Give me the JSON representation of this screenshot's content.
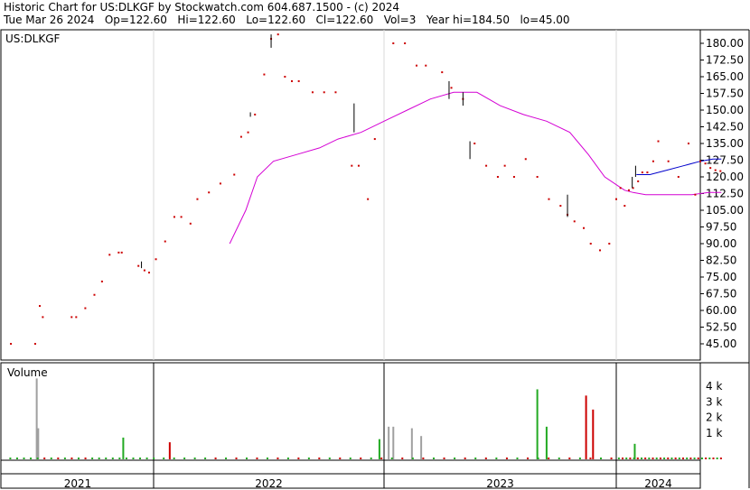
{
  "header": {
    "line1": "Historic Chart for US:DLKGF by Stockwatch.com 604.687.1500 - (c) 2024",
    "line2": "Tue Mar 26 2024   Op=122.60   Hi=122.60   Lo=122.60   Cl=122.60   Vol=3   Year hi=184.50   lo=45.00"
  },
  "chart_data": [
    {
      "type": "line",
      "title": "US:DLKGF",
      "ylim": [
        40,
        184
      ],
      "y_ticks": [
        "180.00",
        "172.50",
        "165.00",
        "157.50",
        "150.00",
        "142.50",
        "135.00",
        "127.50",
        "120.00",
        "112.50",
        "105.00",
        "97.50",
        "90.00",
        "82.50",
        "75.00",
        "67.50",
        "60.00",
        "52.50",
        "45.00"
      ],
      "x_ticks": [
        "2021",
        "2022",
        "2023",
        "2024"
      ],
      "price_points": [
        [
          0.06,
          45
        ],
        [
          0.22,
          45
        ],
        [
          0.25,
          62
        ],
        [
          0.27,
          57
        ],
        [
          0.46,
          57
        ],
        [
          0.49,
          57
        ],
        [
          0.55,
          61
        ],
        [
          0.61,
          67
        ],
        [
          0.66,
          73
        ],
        [
          0.71,
          85
        ],
        [
          0.77,
          86
        ],
        [
          0.79,
          86
        ],
        [
          0.9,
          80
        ],
        [
          0.94,
          78
        ],
        [
          0.97,
          77
        ],
        [
          1.01,
          83
        ],
        [
          1.05,
          91
        ],
        [
          1.09,
          102
        ],
        [
          1.12,
          102
        ],
        [
          1.16,
          99
        ],
        [
          1.19,
          110
        ],
        [
          1.24,
          113
        ],
        [
          1.29,
          117
        ],
        [
          1.35,
          121
        ],
        [
          1.38,
          138
        ],
        [
          1.41,
          140
        ],
        [
          1.44,
          148
        ],
        [
          1.48,
          166
        ],
        [
          1.51,
          182
        ],
        [
          1.54,
          184
        ],
        [
          1.57,
          165
        ],
        [
          1.6,
          163
        ],
        [
          1.63,
          163
        ],
        [
          1.69,
          158
        ],
        [
          1.74,
          158
        ],
        [
          1.79,
          158
        ],
        [
          1.86,
          125
        ],
        [
          1.89,
          125
        ],
        [
          1.93,
          110
        ],
        [
          1.96,
          137
        ],
        [
          2.04,
          180
        ],
        [
          2.09,
          180
        ],
        [
          2.14,
          170
        ],
        [
          2.18,
          170
        ],
        [
          2.25,
          167
        ],
        [
          2.29,
          160
        ],
        [
          2.34,
          155
        ],
        [
          2.39,
          135
        ],
        [
          2.44,
          125
        ],
        [
          2.49,
          120
        ],
        [
          2.52,
          125
        ],
        [
          2.56,
          120
        ],
        [
          2.61,
          128
        ],
        [
          2.66,
          120
        ],
        [
          2.71,
          110
        ],
        [
          2.76,
          107
        ],
        [
          2.79,
          103
        ],
        [
          2.82,
          100
        ],
        [
          2.86,
          97
        ],
        [
          2.89,
          90
        ],
        [
          2.93,
          87
        ],
        [
          2.97,
          90
        ],
        [
          3.0,
          110
        ],
        [
          3.05,
          115
        ],
        [
          3.1,
          107
        ],
        [
          3.15,
          114
        ],
        [
          3.2,
          115
        ],
        [
          3.26,
          118
        ],
        [
          3.31,
          122
        ],
        [
          3.37,
          122
        ],
        [
          3.44,
          127
        ],
        [
          3.5,
          136
        ],
        [
          3.62,
          127
        ],
        [
          3.74,
          120
        ],
        [
          3.86,
          135
        ],
        [
          3.94,
          112
        ],
        [
          4.0,
          127
        ],
        [
          4.06,
          126
        ],
        [
          4.12,
          124
        ],
        [
          4.18,
          123
        ],
        [
          4.24,
          122.6
        ]
      ],
      "series": [
        {
          "name": "",
          "color": "#d400d4",
          "points": [
            [
              1.33,
              90
            ],
            [
              1.4,
              105
            ],
            [
              1.45,
              120
            ],
            [
              1.52,
              127
            ],
            [
              1.62,
              130
            ],
            [
              1.72,
              133
            ],
            [
              1.8,
              137
            ],
            [
              1.9,
              140
            ],
            [
              2.0,
              145
            ],
            [
              2.1,
              150
            ],
            [
              2.2,
              155
            ],
            [
              2.3,
              158
            ],
            [
              2.4,
              158
            ],
            [
              2.5,
              152
            ],
            [
              2.6,
              148
            ],
            [
              2.7,
              145
            ],
            [
              2.8,
              140
            ],
            [
              2.88,
              130
            ],
            [
              2.95,
              120
            ],
            [
              3.02,
              116
            ],
            [
              3.1,
              114
            ],
            [
              3.2,
              113
            ],
            [
              3.35,
              112
            ],
            [
              3.5,
              112
            ],
            [
              3.7,
              112
            ],
            [
              3.9,
              112
            ],
            [
              4.1,
              113
            ],
            [
              4.25,
              113
            ]
          ]
        },
        {
          "name": "",
          "color": "#0000cc",
          "points": [
            [
              3.24,
              121
            ],
            [
              3.4,
              121
            ],
            [
              3.6,
              123
            ],
            [
              3.8,
              125
            ],
            [
              4.0,
              127
            ],
            [
              4.15,
              128
            ],
            [
              4.25,
              128
            ]
          ]
        }
      ]
    },
    {
      "type": "bar",
      "title": "Volume",
      "ylim": [
        0,
        5000
      ],
      "y_ticks": [
        "4 k",
        "3 k",
        "2 k",
        "1 k"
      ],
      "bars": [
        {
          "x": 0.23,
          "v": 4500,
          "color": "#a0a0a0"
        },
        {
          "x": 0.24,
          "v": 1300,
          "color": "#a0a0a0"
        },
        {
          "x": 0.8,
          "v": 700,
          "color": "#22aa22"
        },
        {
          "x": 1.07,
          "v": 400,
          "color": "#cc0000"
        },
        {
          "x": 1.98,
          "v": 600,
          "color": "#22aa22"
        },
        {
          "x": 2.02,
          "v": 1400,
          "color": "#a0a0a0"
        },
        {
          "x": 2.04,
          "v": 1400,
          "color": "#a0a0a0"
        },
        {
          "x": 2.12,
          "v": 1300,
          "color": "#a0a0a0"
        },
        {
          "x": 2.16,
          "v": 800,
          "color": "#a0a0a0"
        },
        {
          "x": 2.66,
          "v": 3800,
          "color": "#22aa22"
        },
        {
          "x": 2.7,
          "v": 1400,
          "color": "#22aa22"
        },
        {
          "x": 2.87,
          "v": 3400,
          "color": "#cc0000"
        },
        {
          "x": 2.9,
          "v": 2500,
          "color": "#cc0000"
        },
        {
          "x": 3.22,
          "v": 300,
          "color": "#22aa22"
        }
      ]
    }
  ],
  "volume_label": "Volume"
}
